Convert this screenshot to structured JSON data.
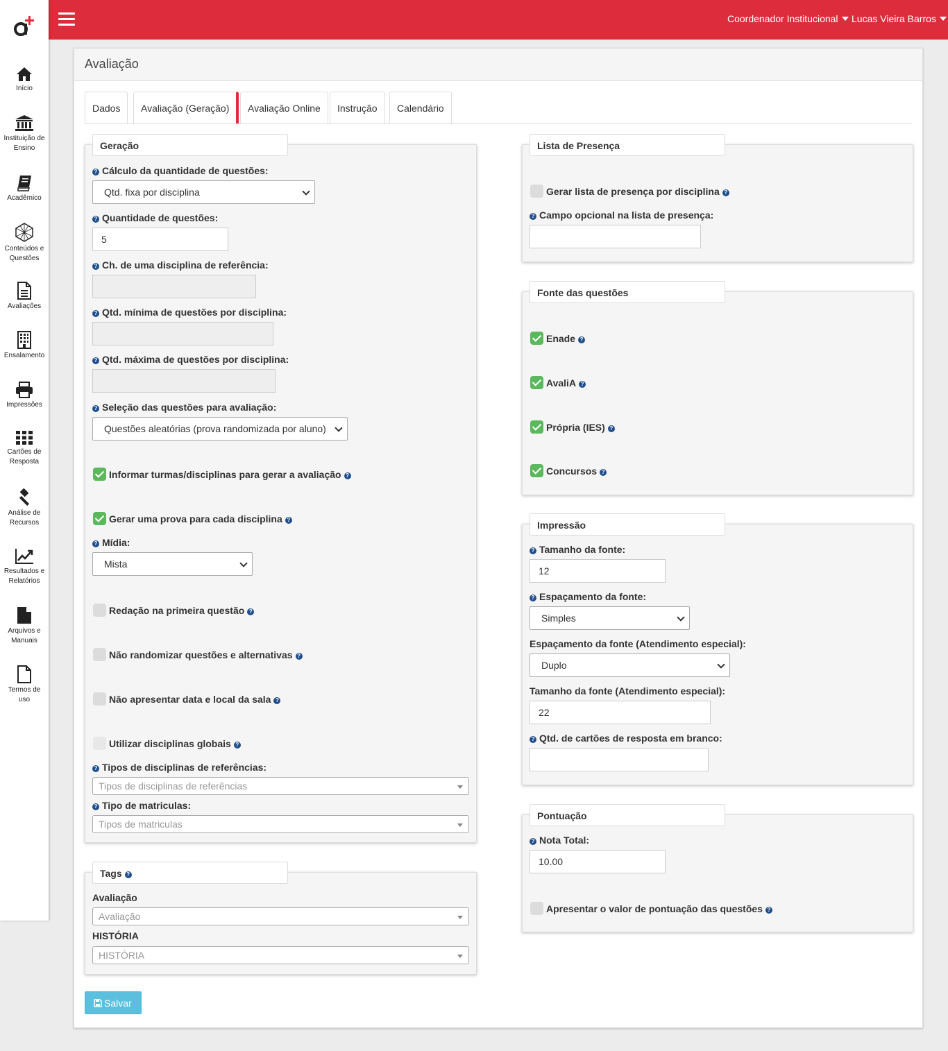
{
  "colors": {
    "topbar": "#dd2c3b",
    "primary": "#5bc0de",
    "check": "#5cb85c",
    "help": "#1f4e8c"
  },
  "sidebar": {
    "items": [
      {
        "icon": "home-icon",
        "label1": "Início",
        "label2": ""
      },
      {
        "icon": "institution-icon",
        "label1": "Instituição de",
        "label2": "Ensino"
      },
      {
        "icon": "book-icon",
        "label1": "Acadêmico",
        "label2": ""
      },
      {
        "icon": "network-icon",
        "label1": "Conteúdos e",
        "label2": "Questões"
      },
      {
        "icon": "document-icon",
        "label1": "Avaliações",
        "label2": ""
      },
      {
        "icon": "building-icon",
        "label1": "Ensalamento",
        "label2": ""
      },
      {
        "icon": "printer-icon",
        "label1": "Impressões",
        "label2": ""
      },
      {
        "icon": "grid-icon",
        "label1": "Cartões de",
        "label2": "Resposta"
      },
      {
        "icon": "gavel-icon",
        "label1": "Análise de",
        "label2": "Recursos"
      },
      {
        "icon": "chart-icon",
        "label1": "Resultados e",
        "label2": "Relatórios"
      },
      {
        "icon": "file-icon",
        "label1": "Arquivos e",
        "label2": "Manuais"
      },
      {
        "icon": "file-outline-icon",
        "label1": "Termos de",
        "label2": "uso"
      }
    ]
  },
  "header": {
    "role": "Coordenador Institucional",
    "user": "Lucas Vieira Barros"
  },
  "page": {
    "title": "Avaliação"
  },
  "tabs": [
    "Dados",
    "Avaliação (Geração)",
    "Avaliação Online",
    "Instrução",
    "Calendário"
  ],
  "geracao": {
    "legend": "Geração",
    "calc_label": "Cálculo da quantidade de questões:",
    "calc_value": "Qtd. fixa por disciplina",
    "qtd_label": "Quantidade de questões:",
    "qtd_value": "5",
    "ch_label": "Ch. de uma disciplina de referência:",
    "min_label": "Qtd. mínima de questões por disciplina:",
    "max_label": "Qtd. máxima de questões por disciplina:",
    "selecao_label": "Seleção das questões para avaliação:",
    "selecao_value": "Questões aleatórias (prova randomizada por aluno)",
    "informar_label": "Informar turmas/disciplinas para gerar a avaliação",
    "informar_checked": true,
    "cada_label": "Gerar uma prova para cada disciplina",
    "cada_checked": true,
    "midia_label": "Mídia:",
    "midia_value": "Mista",
    "redacao_label": "Redação na primeira questão",
    "redacao_checked": false,
    "naorand_label": "Não randomizar questões e alternativas",
    "naorand_checked": false,
    "naodata_label": "Não apresentar data e local da sala",
    "naodata_checked": false,
    "globais_label": "Utilizar disciplinas globais",
    "globais_checked": false,
    "tipos_label": "Tipos de disciplinas de referências:",
    "tipos_placeholder": "Tipos de disciplinas de referências",
    "matric_label": "Tipo de matriculas:",
    "matric_placeholder": "Tipos de matriculas"
  },
  "tags": {
    "legend": "Tags",
    "aval_label": "Avaliação",
    "aval_placeholder": "Avaliação",
    "hist_label": "HISTÓRIA",
    "hist_placeholder": "HISTÓRIA"
  },
  "presenca": {
    "legend": "Lista de Presença",
    "gerar_label": "Gerar lista de presença por disciplina",
    "gerar_checked": false,
    "campo_label": "Campo opcional na lista de presença:",
    "campo_value": ""
  },
  "fonte": {
    "legend": "Fonte das questões",
    "items": [
      {
        "label": "Enade",
        "checked": true
      },
      {
        "label": "AvaliA",
        "checked": true
      },
      {
        "label": "Própria (IES)",
        "checked": true
      },
      {
        "label": "Concursos",
        "checked": true
      }
    ]
  },
  "impressao": {
    "legend": "Impressão",
    "tam_label": "Tamanho da fonte:",
    "tam_value": "12",
    "esp_label": "Espaçamento da fonte:",
    "esp_value": "Simples",
    "espesp_label": "Espaçamento da fonte (Atendimento especial):",
    "espesp_value": "Duplo",
    "tamesp_label": "Tamanho da fonte (Atendimento especial):",
    "tamesp_value": "22",
    "cartoes_label": "Qtd. de cartões de resposta em branco:",
    "cartoes_value": ""
  },
  "pontuacao": {
    "legend": "Pontuação",
    "nota_label": "Nota Total:",
    "nota_value": "10.00",
    "apresentar_label": "Apresentar o valor de pontuação das questões",
    "apresentar_checked": false
  },
  "actions": {
    "save_label": "Salvar"
  }
}
